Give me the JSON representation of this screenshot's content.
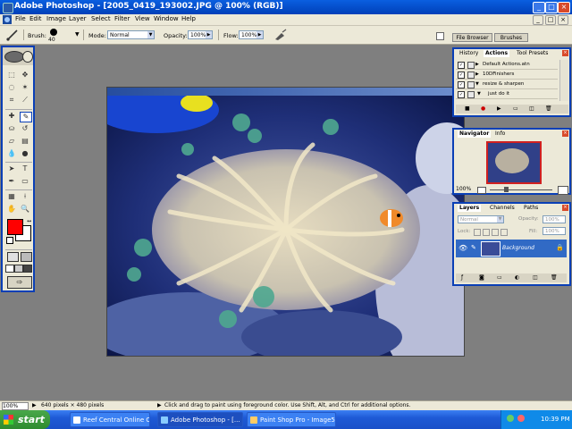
{
  "window": {
    "title": "Adobe Photoshop - [2005_0419_193002.JPG @ 100% (RGB)]",
    "min_glyph": "_",
    "max_glyph": "□",
    "close_glyph": "×"
  },
  "menu": {
    "items": [
      "File",
      "Edit",
      "Image",
      "Layer",
      "Select",
      "Filter",
      "View",
      "Window",
      "Help"
    ]
  },
  "options": {
    "brush_label": "Brush:",
    "brush_size": "40",
    "mode_label": "Mode:",
    "mode_value": "Normal",
    "opacity_label": "Opacity:",
    "opacity_value": "100%",
    "flow_label": "Flow:",
    "flow_value": "100%",
    "file_browser_tab": "File Browser",
    "brushes_tab": "Brushes"
  },
  "history_palette": {
    "tabs": [
      "History",
      "Actions",
      "Tool Presets"
    ],
    "actions": [
      {
        "label": "Default Actions.atn",
        "checked": "✓"
      },
      {
        "label": "10DFinishers",
        "checked": "✓"
      },
      {
        "label": "resize & sharpen",
        "checked": "✓"
      },
      {
        "label": "just do it",
        "checked": "✓"
      }
    ]
  },
  "navigator_palette": {
    "tabs": [
      "Navigator",
      "Info"
    ],
    "zoom": "100%"
  },
  "layers_palette": {
    "tabs": [
      "Layers",
      "Channels",
      "Paths"
    ],
    "blend_mode": "Normal",
    "opacity_label": "Opacity:",
    "opacity_value": "100%",
    "lock_label": "Lock:",
    "fill_label": "Fill:",
    "fill_value": "100%",
    "layer_name": "Background"
  },
  "statusbar": {
    "zoom": "100%",
    "doc_size": "640 pixels × 480 pixels",
    "hint": "Click and drag to paint using foreground color.  Use Shift, Alt, and Ctrl for additional options."
  },
  "taskbar": {
    "start_label": "start",
    "tasks": [
      "Reef Central Online C...",
      "Adobe Photoshop - [...",
      "Paint Shop Pro - Image5"
    ],
    "clock": "10:39 PM"
  },
  "colors": {
    "xp_blue": "#0a3fb6",
    "foreground_color": "#ff0000",
    "background_color": "#ffffff",
    "layer_selected": "#316ac5"
  }
}
